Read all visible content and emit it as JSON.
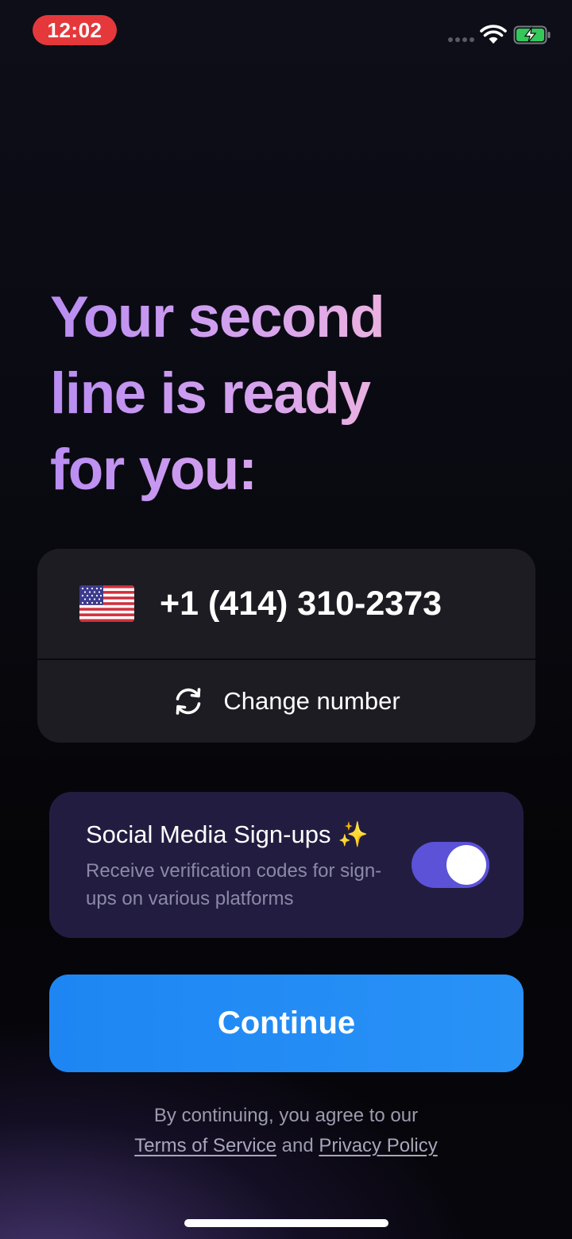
{
  "status_bar": {
    "time": "12:02",
    "time_pill_color": "#e5383b",
    "wifi_icon": "wifi-icon",
    "battery_icon": "battery-charging-icon"
  },
  "headline": {
    "line1": "Your second",
    "line2": "line is ready",
    "line3": "for you:"
  },
  "number_card": {
    "flag_icon": "us-flag-icon",
    "phone_number": "+1 (414) 310-2373",
    "change_icon": "refresh-icon",
    "change_label": "Change number"
  },
  "social_signups": {
    "title": "Social Media Sign-ups ✨",
    "description": "Receive verification codes for sign-ups on various platforms",
    "toggle_on": true,
    "toggle_color": "#5b52d8"
  },
  "continue_button": {
    "label": "Continue",
    "color": "#1e86f2"
  },
  "legal": {
    "prefix": "By continuing, you agree to our",
    "terms_label": "Terms of Service",
    "conjunction": "and",
    "privacy_label": "Privacy Policy"
  }
}
